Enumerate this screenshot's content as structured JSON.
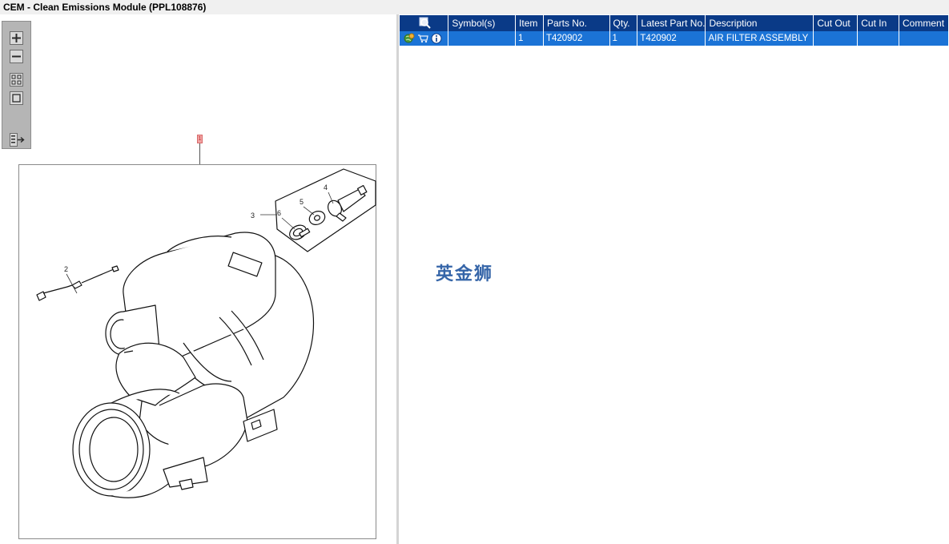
{
  "window": {
    "title": "CEM - Clean Emissions Module (PPL108876)"
  },
  "toolbar": {
    "buttons": [
      {
        "name": "zoom-in",
        "icon": "plus-icon"
      },
      {
        "name": "zoom-out",
        "icon": "minus-icon"
      },
      {
        "name": "fit-all",
        "icon": "grid-icon"
      },
      {
        "name": "fit-window",
        "icon": "square-icon"
      },
      {
        "name": "export",
        "icon": "export-arrow-icon"
      }
    ]
  },
  "diagram": {
    "page_callout": "1",
    "labels": [
      "2",
      "3",
      "4",
      "5",
      "6"
    ]
  },
  "table": {
    "headers": {
      "select": "magnifier-icon",
      "symbols": "Symbol(s)",
      "item": "Item",
      "parts_no": "Parts No.",
      "qty": "Qty.",
      "latest_part_no": "Latest Part No.",
      "description": "Description",
      "cut_out": "Cut Out",
      "cut_in": "Cut In",
      "comment": "Comment"
    },
    "rows": [
      {
        "icons": [
          "location-globe-icon",
          "cart-icon",
          "info-icon"
        ],
        "symbols": "",
        "item": "1",
        "parts_no": "T420902",
        "qty": "1",
        "latest_part_no": "T420902",
        "description": "AIR FILTER ASSEMBLY",
        "cut_out": "",
        "cut_in": "",
        "comment": ""
      }
    ]
  },
  "watermark": "英金狮",
  "colors": {
    "header_bg": "#0a3a87",
    "selected_row_bg": "#1b73d6",
    "watermark": "#3565a8",
    "callout": "#f2a3a3"
  }
}
